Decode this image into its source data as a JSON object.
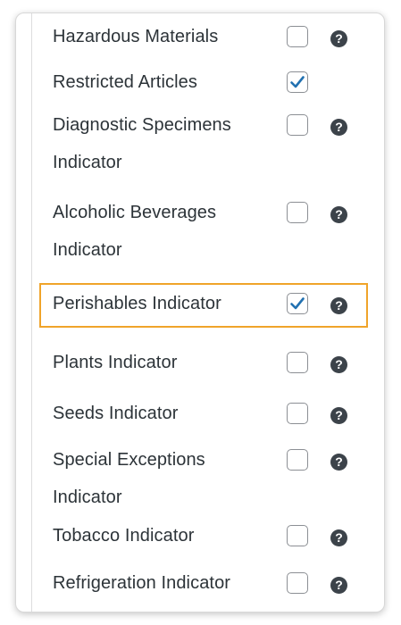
{
  "options": [
    {
      "label": "Hazardous Materials",
      "checked": false,
      "help_icon": true
    },
    {
      "label": "Restricted Articles",
      "checked": true,
      "help_icon": false
    },
    {
      "label": "Diagnostic Specimens Indicator",
      "checked": false,
      "help_icon": true
    },
    {
      "label": "Alcoholic Beverages Indicator",
      "checked": false,
      "help_icon": true
    },
    {
      "label": "Perishables Indicator",
      "checked": true,
      "help_icon": true,
      "highlighted": true
    },
    {
      "label": "Plants Indicator",
      "checked": false,
      "help_icon": true
    },
    {
      "label": "Seeds Indicator",
      "checked": false,
      "help_icon": true
    },
    {
      "label": "Special Exceptions Indicator",
      "checked": false,
      "help_icon": true
    },
    {
      "label": "Tobacco Indicator",
      "checked": false,
      "help_icon": true
    },
    {
      "label": "Refrigeration Indicator",
      "checked": false,
      "help_icon": true
    }
  ],
  "help_glyph": "?",
  "colors": {
    "highlight": "#f0a42a",
    "checkmark": "#2271b1",
    "help_icon_bg": "#3c434a"
  }
}
